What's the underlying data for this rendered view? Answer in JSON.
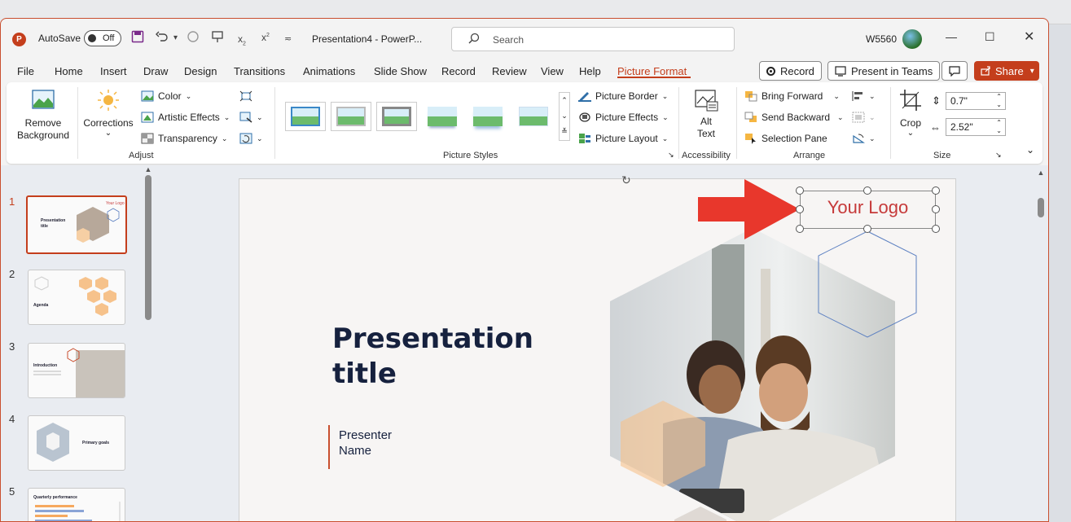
{
  "window": {
    "app_badge": "P",
    "autosave_label": "AutoSave",
    "autosave_state": "Off",
    "doc_title": "Presentation4  -  PowerP...",
    "search_placeholder": "Search",
    "user": "W5560",
    "subscript": "x",
    "superscript": "x",
    "sub_mark": "2",
    "sup_mark": "2"
  },
  "menu": [
    "File",
    "Home",
    "Insert",
    "Draw",
    "Design",
    "Transitions",
    "Animations",
    "Slide Show",
    "Record",
    "Review",
    "View",
    "Help",
    "Picture Format"
  ],
  "menu_active": "Picture Format",
  "actions": {
    "record": "Record",
    "present_teams": "Present in Teams",
    "share": "Share"
  },
  "ribbon": {
    "adjust": {
      "remove_background": [
        "Remove",
        "Background"
      ],
      "corrections": "Corrections",
      "color": "Color",
      "artistic_effects": "Artistic Effects",
      "transparency": "Transparency",
      "label": "Adjust"
    },
    "picture_styles": {
      "label": "Picture Styles",
      "border": "Picture Border",
      "effects": "Picture Effects",
      "layout": "Picture Layout"
    },
    "accessibility": {
      "alt_text": [
        "Alt",
        "Text"
      ],
      "label": "Accessibility"
    },
    "arrange": {
      "bring_forward": "Bring Forward",
      "send_backward": "Send Backward",
      "selection_pane": "Selection Pane",
      "label": "Arrange"
    },
    "size": {
      "crop": "Crop",
      "height": "0.7\"",
      "width": "2.52\"",
      "label": "Size"
    }
  },
  "thumbnails": [
    {
      "num": "1",
      "title": "Presentation title",
      "logo": "Your Logo"
    },
    {
      "num": "2",
      "title": "Agenda"
    },
    {
      "num": "3",
      "title": "Introduction"
    },
    {
      "num": "4",
      "title": "Primary goals"
    },
    {
      "num": "5",
      "title": "Quarterly performance"
    }
  ],
  "slide": {
    "title_line1": "Presentation",
    "title_line2": "title",
    "presenter_line1": "Presenter",
    "presenter_line2": "Name",
    "logo_text": "Your Logo"
  },
  "colors": {
    "accent": "#c43e1c",
    "arrow": "#e8372c",
    "logo": "#c63a3a",
    "title": "#16213e"
  }
}
